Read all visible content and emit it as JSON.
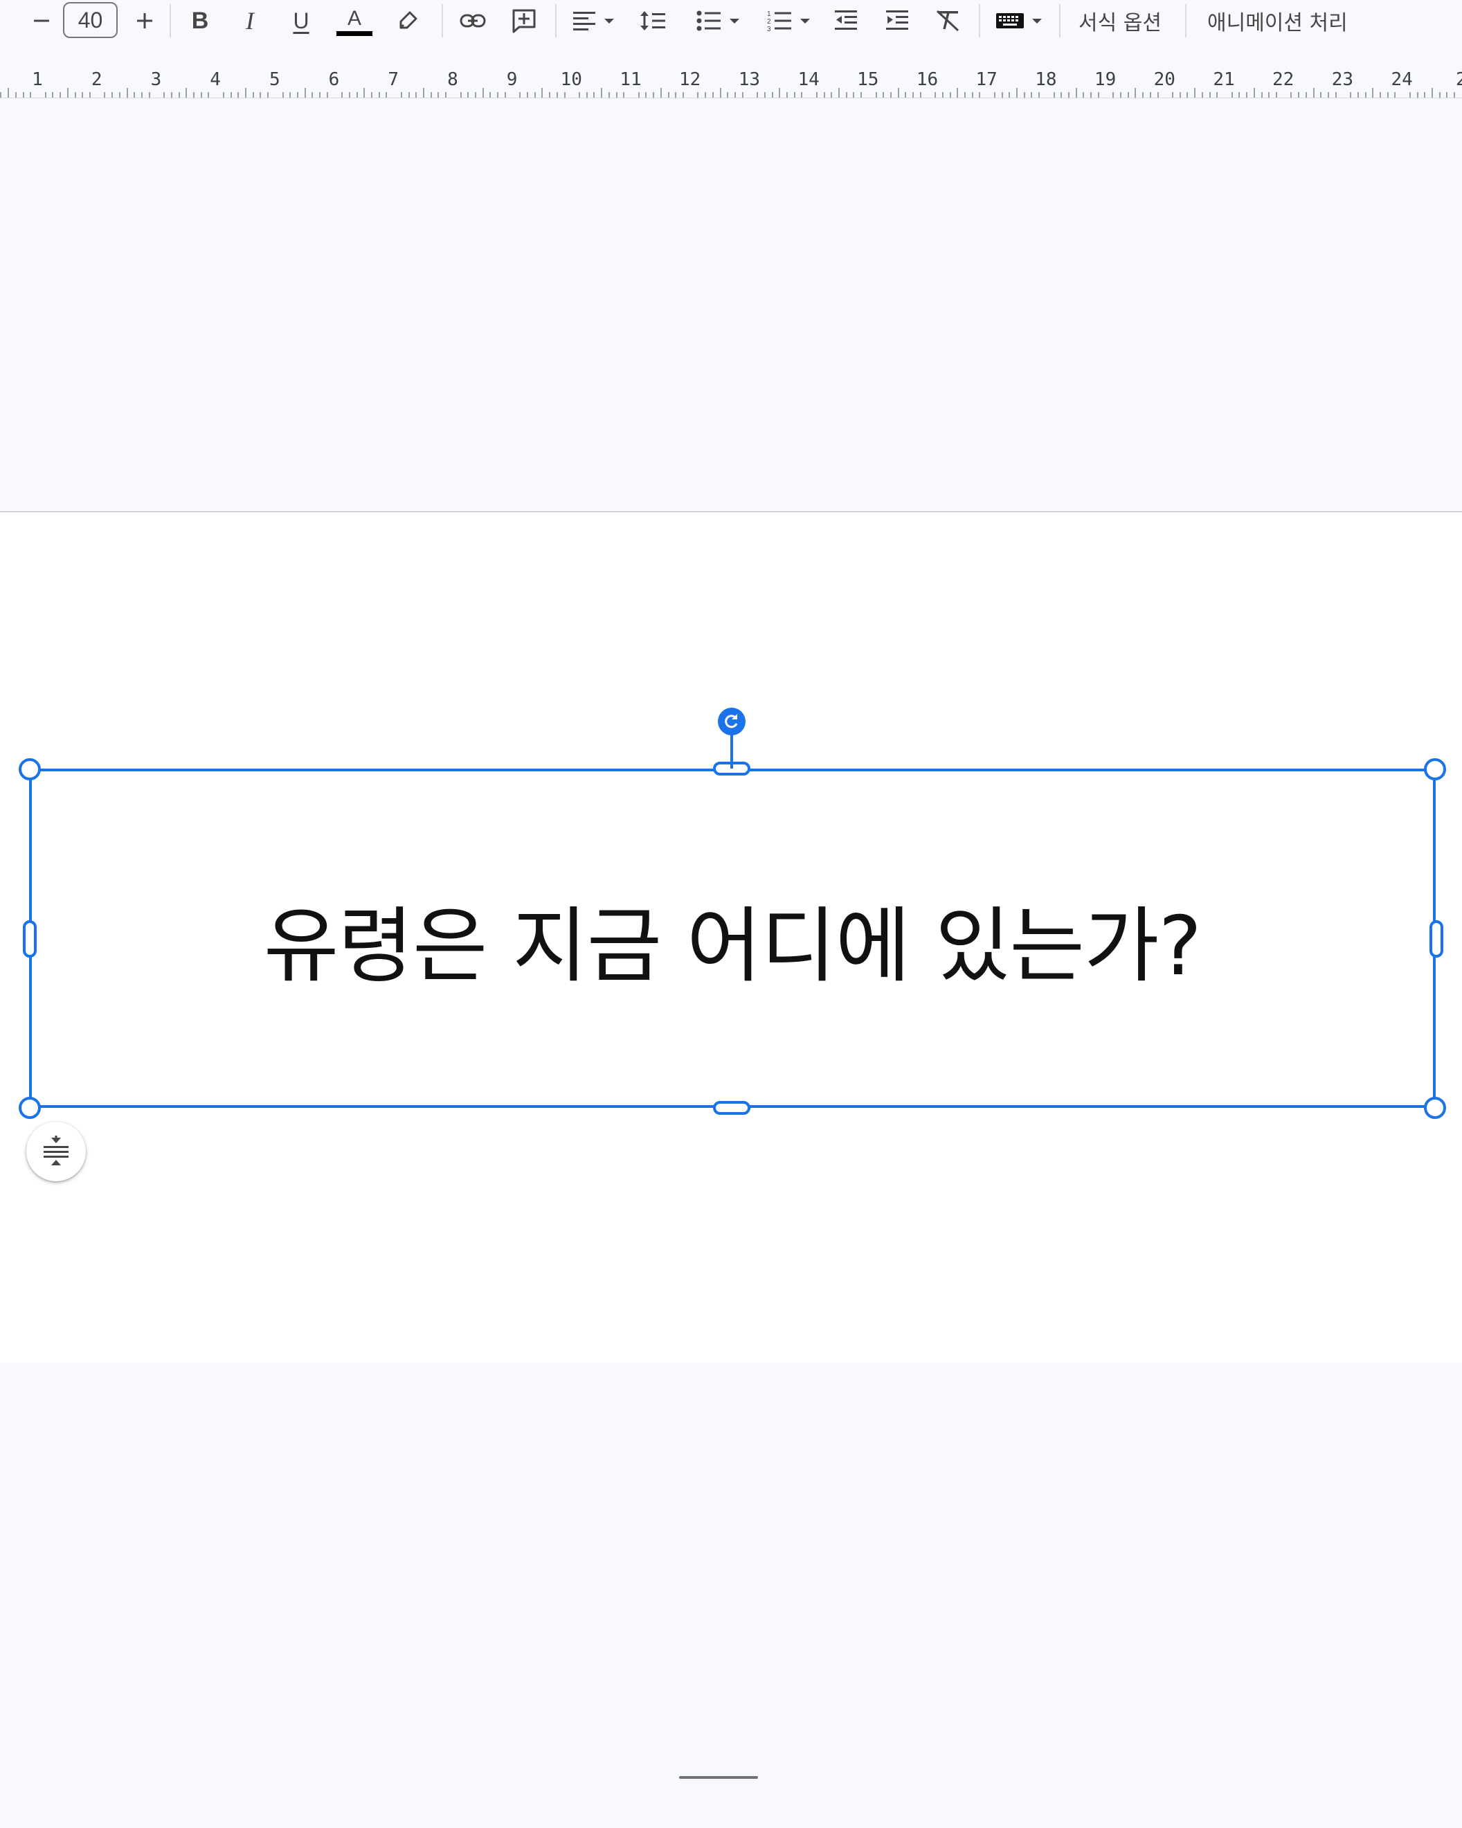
{
  "toolbar": {
    "decrease_font_glyph": "−",
    "font_size": "40",
    "increase_font_glyph": "+",
    "bold_glyph": "B",
    "italic_glyph": "I",
    "underline_glyph": "U",
    "text_color_glyph": "A",
    "text_color": "#000000",
    "format_options_label": "서식 옵션",
    "animation_label": "애니메이션 처리",
    "icons": [
      "minus-icon",
      "plus-icon",
      "bold-icon",
      "italic-icon",
      "underline-icon",
      "text-color-icon",
      "highlight-icon",
      "link-icon",
      "add-comment-icon",
      "align-left-icon",
      "line-spacing-icon",
      "bulleted-list-icon",
      "numbered-list-icon",
      "decrease-indent-icon",
      "increase-indent-icon",
      "clear-formatting-icon",
      "keyboard-icon"
    ]
  },
  "ruler": {
    "numbers": [
      "1",
      "2",
      "3",
      "4",
      "5",
      "6",
      "7",
      "8",
      "9",
      "10",
      "11",
      "12",
      "13",
      "14",
      "15",
      "16",
      "17",
      "18",
      "19",
      "20",
      "21",
      "22",
      "23",
      "24",
      "2"
    ]
  },
  "slide": {
    "text": "유령은 지금 어디에 있는가?"
  },
  "colors": {
    "accent": "#1a73e8",
    "background": "#f8f9fd",
    "slide": "#ffffff"
  }
}
